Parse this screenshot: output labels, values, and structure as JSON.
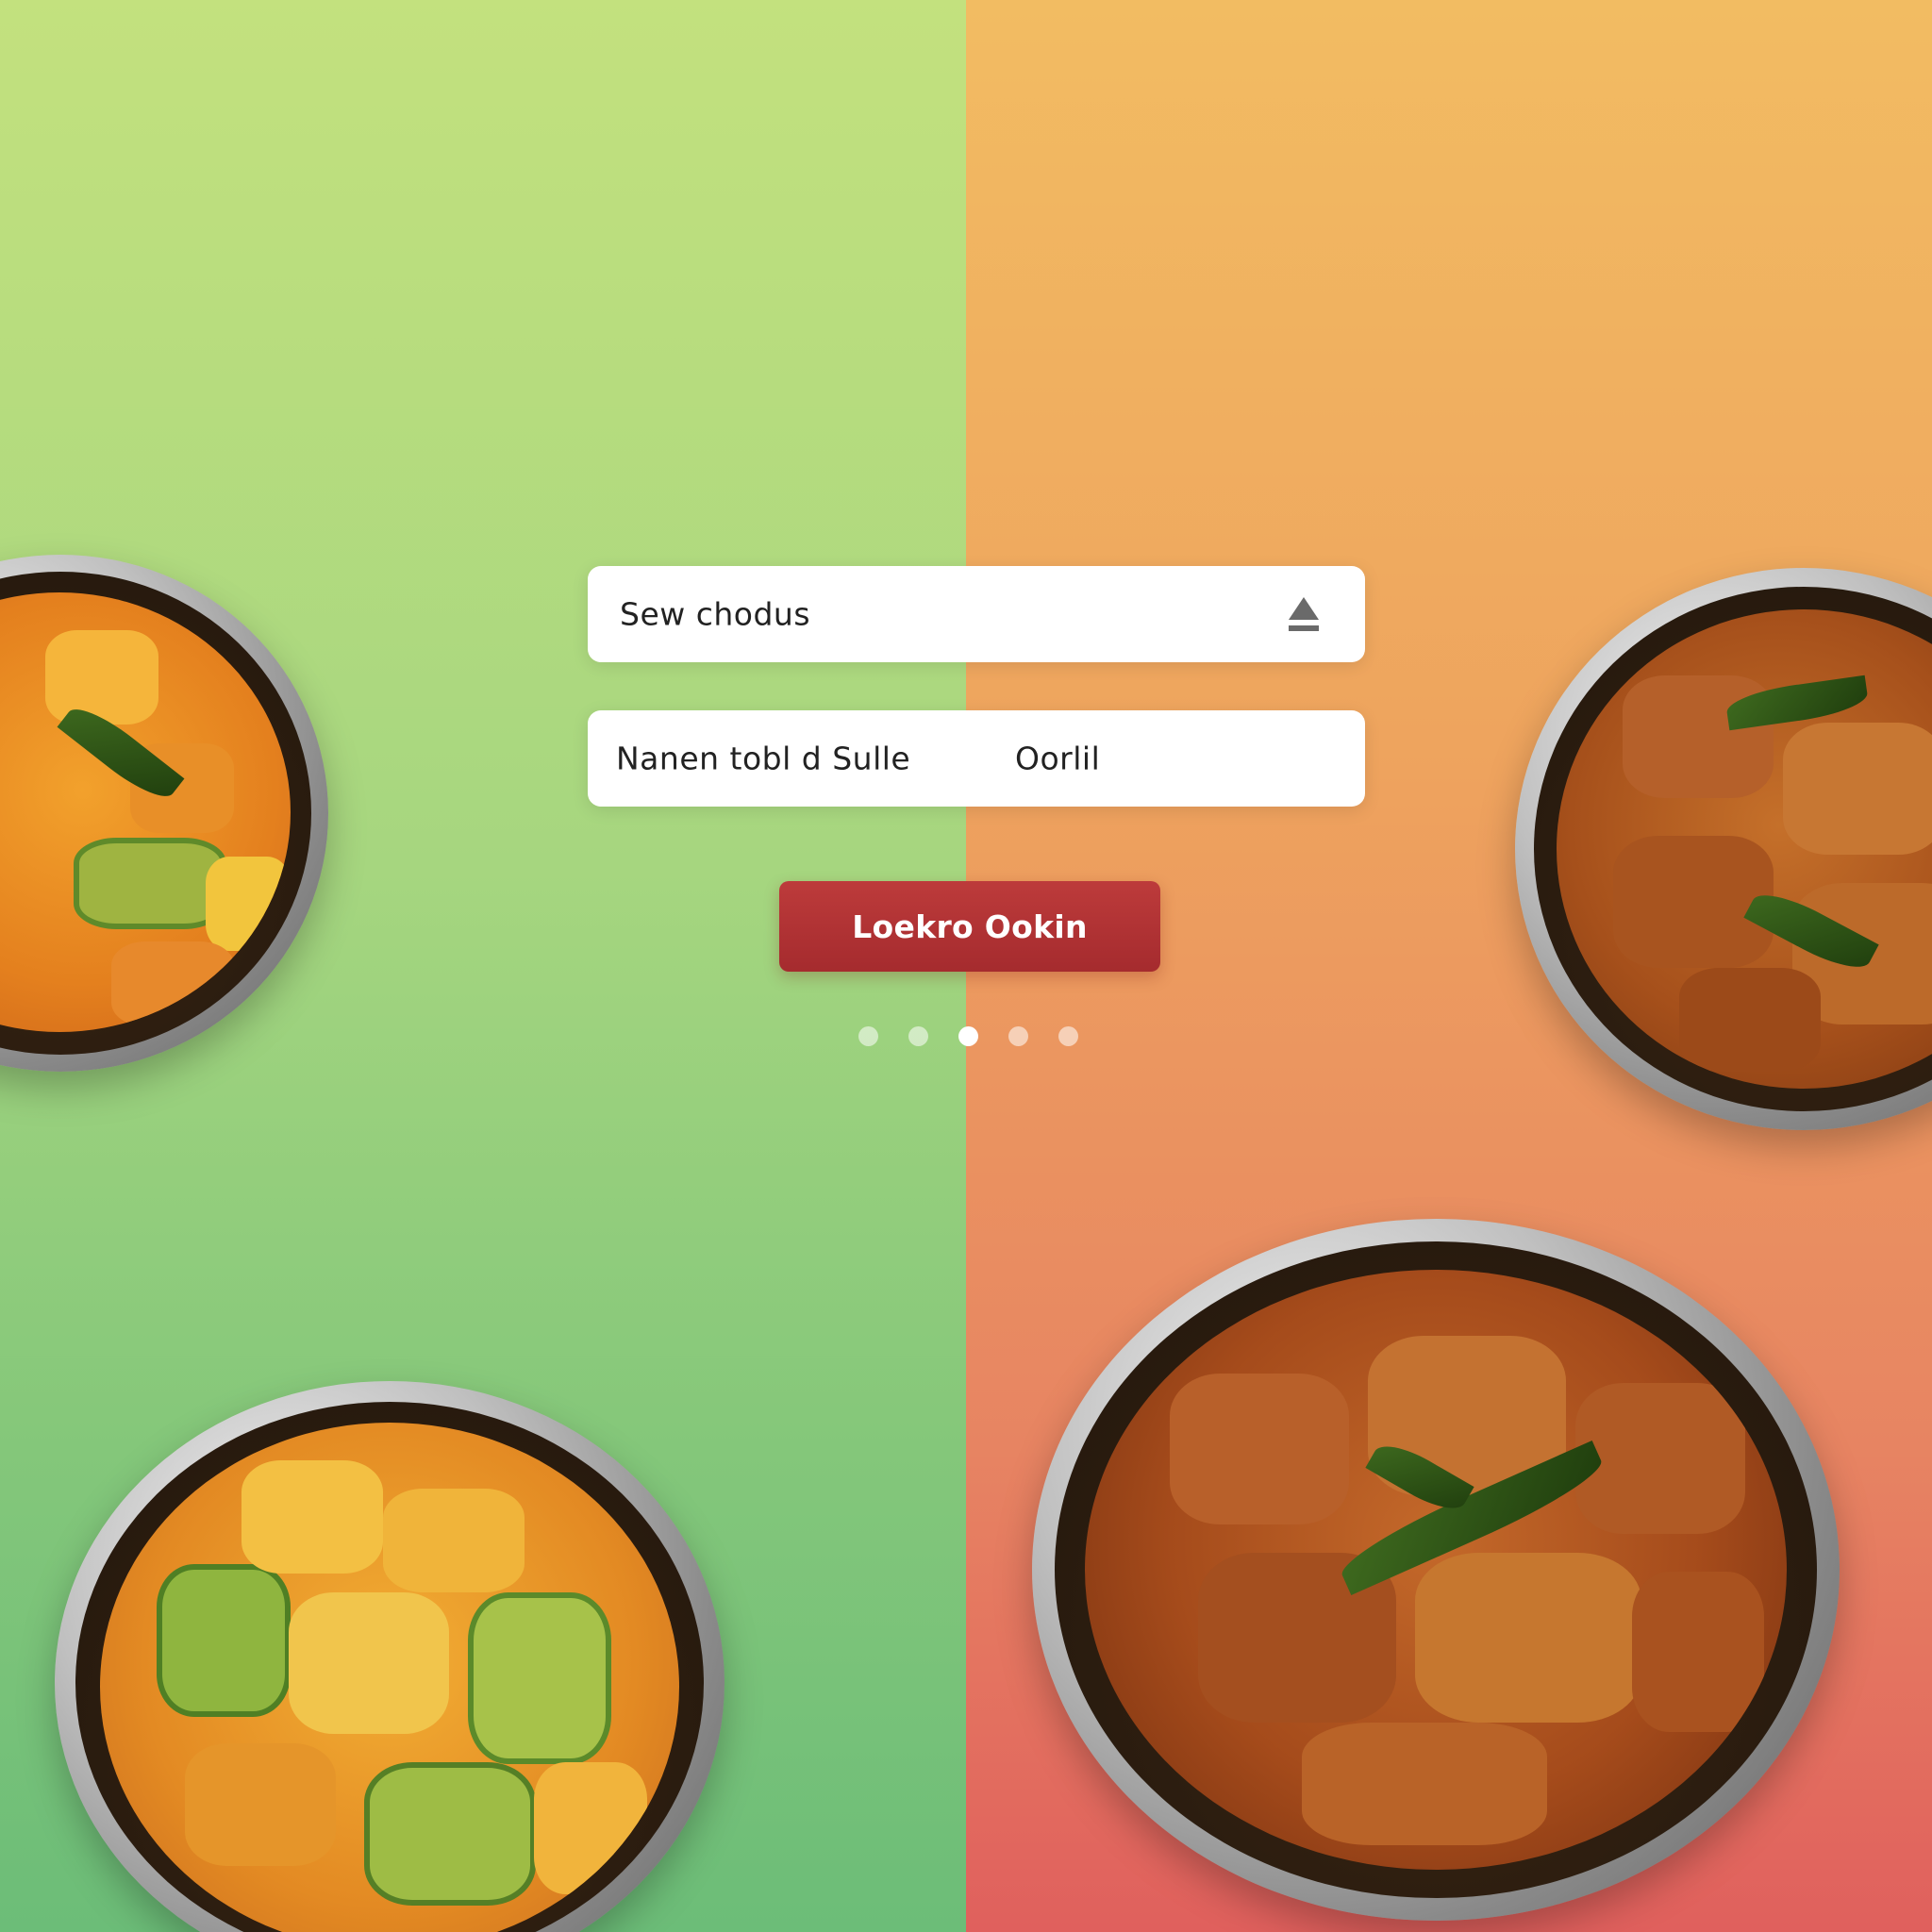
{
  "form": {
    "field_one": {
      "value": "Sew chodus",
      "icon": "upload-icon"
    },
    "field_two": {
      "label_left": "Nanen tobl d Sulle",
      "label_right": "Oorlil"
    },
    "primary_button_label": "Loekro Ookin"
  },
  "carousel": {
    "pages": 5,
    "active_index": 2
  },
  "colors": {
    "left_panel": "#a6d67f",
    "right_panel": "#eea35e",
    "button": "#b23434"
  },
  "images": [
    "mango-pickle-bowl-icon",
    "chicken-pickle-bowl-icon"
  ]
}
